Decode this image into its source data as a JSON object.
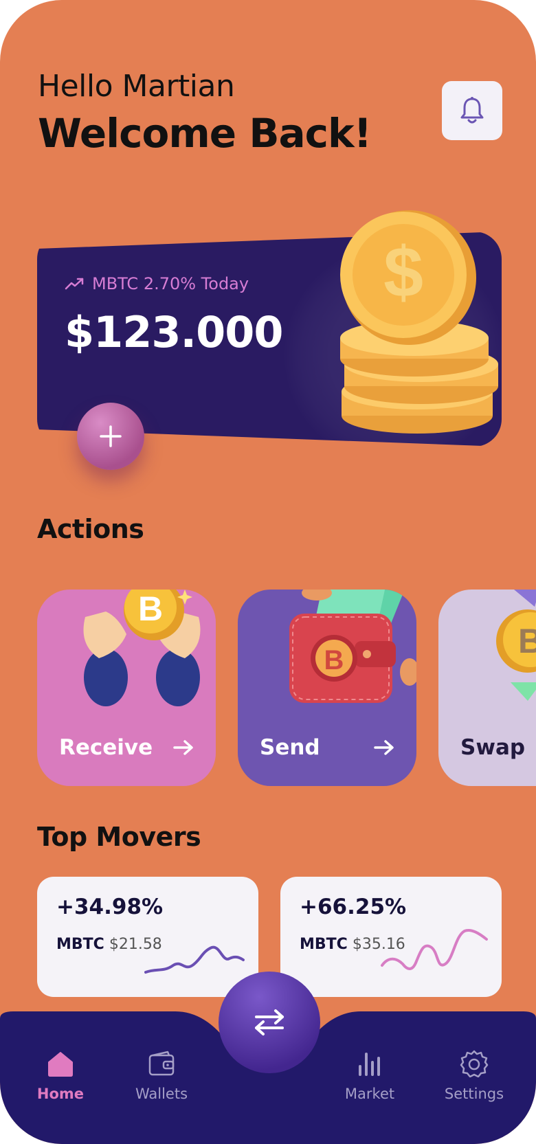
{
  "header": {
    "greeting": "Hello Martian",
    "welcome": "Welcome Back!"
  },
  "balance": {
    "trend_text": "MBTC 2.70% Today",
    "amount": "$123.000"
  },
  "actions": {
    "title": "Actions",
    "items": [
      {
        "label": "Receive"
      },
      {
        "label": "Send"
      },
      {
        "label": "Swap"
      }
    ]
  },
  "movers": {
    "title": "Top Movers",
    "items": [
      {
        "change": "+34.98%",
        "symbol": "MBTC",
        "price": "$21.58",
        "color": "#6A4FB3"
      },
      {
        "change": "+66.25%",
        "symbol": "MBTC",
        "price": "$35.16",
        "color": "#D77DC4"
      }
    ]
  },
  "nav": {
    "items": [
      {
        "label": "Home",
        "icon": "home-icon",
        "active": true
      },
      {
        "label": "Wallets",
        "icon": "wallet-icon"
      },
      {
        "label": "Market",
        "icon": "bar-chart-icon"
      },
      {
        "label": "Settings",
        "icon": "gear-icon"
      }
    ]
  },
  "colors": {
    "background": "#E47F53",
    "card_dark": "#2A1B62",
    "accent_pink": "#D77DC4",
    "accent_purple": "#6E55B0"
  }
}
